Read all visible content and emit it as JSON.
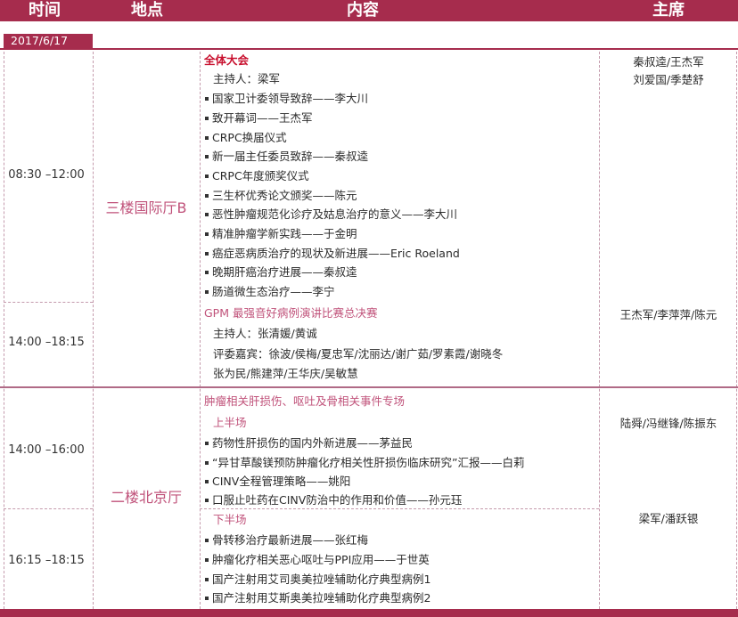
{
  "header": {
    "time": "时间",
    "place": "地点",
    "content": "内容",
    "chair": "主席"
  },
  "date": "2017/6/17",
  "blocks": [
    {
      "time": "08:30 –12:00",
      "title": "全体大会",
      "host": "主持人：梁军",
      "chairs": [
        "秦叔逵/王杰军",
        "刘爱国/季楚舒"
      ],
      "items": [
        "国家卫计委领导致辞——李大川",
        "致开幕词——王杰军",
        "CRPC换届仪式",
        "新一届主任委员致辞——秦叔逵",
        "CRPC年度颁奖仪式",
        "三生杯优秀论文颁奖——陈元",
        "恶性肿瘤规范化诊疗及姑息治疗的意义——李大川",
        "精准肿瘤学新实践——于金明",
        "癌症恶病质治疗的现状及新进展——Eric Roeland",
        "晚期肝癌治疗进展——秦叔逵",
        "肠道微生态治疗——李宁"
      ]
    },
    {
      "time": "14:00 –18:15",
      "title": "GPM 最强音好病例演讲比赛总决赛",
      "host": "主持人：张清媛/黄诚",
      "judges1": "评委嘉宾：徐波/侯梅/夏忠军/沈丽达/谢广茹/罗素霞/谢晓冬",
      "judges2": "张为民/熊建萍/王华庆/吴敏慧",
      "chairs": [
        "王杰军/李萍萍/陈元"
      ]
    }
  ],
  "venue1": "三楼国际厅B",
  "venue2": "二楼北京厅",
  "session2": {
    "title": "肿瘤相关肝损伤、呕吐及骨相关事件专场",
    "part1": {
      "time": "14:00 –16:00",
      "label": "上半场",
      "chairs": "陆舜/冯继锋/陈振东",
      "items": [
        "药物性肝损伤的国内外新进展——茅益民",
        "“异甘草酸镁预防肿瘤化疗相关性肝损伤临床研究”汇报——白莉",
        "CINV全程管理策略——姚阳",
        "口服止吐药在CINV防治中的作用和价值——孙元珏"
      ]
    },
    "part2": {
      "time": "16:15 –18:15",
      "label": "下半场",
      "chairs": "梁军/潘跃银",
      "items": [
        "骨转移治疗最新进展——张红梅",
        "肿瘤化疗相关恶心呕吐与PPI应用——于世英",
        "国产注射用艾司奥美拉唑辅助化疗典型病例1",
        "国产注射用艾斯奥美拉唑辅助化疗典型病例2"
      ]
    }
  }
}
